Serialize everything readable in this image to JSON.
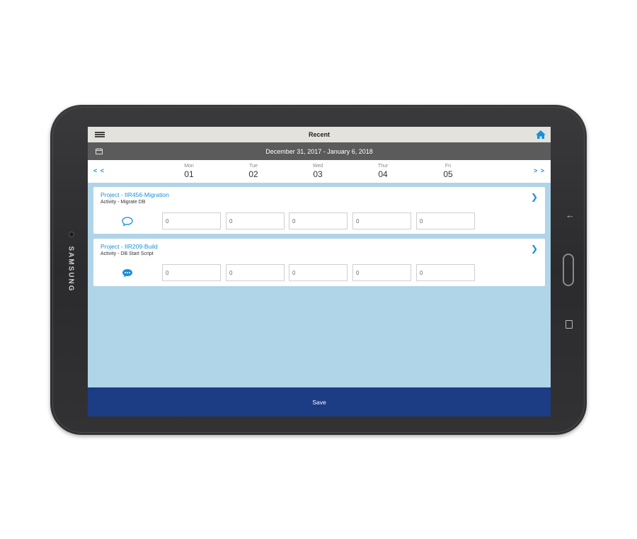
{
  "device": {
    "brand": "SAMSUNG"
  },
  "header": {
    "title": "Recent"
  },
  "date_range": {
    "label": "December 31, 2017 - January 6, 2018"
  },
  "week_nav": {
    "prev": "< <",
    "next": "> >"
  },
  "days": [
    {
      "name": "Mon",
      "date": "01"
    },
    {
      "name": "Tue",
      "date": "02"
    },
    {
      "name": "Wed",
      "date": "03"
    },
    {
      "name": "Thur",
      "date": "04"
    },
    {
      "name": "Fri",
      "date": "05"
    }
  ],
  "entries": [
    {
      "project": "Project - IIR456-Migration",
      "activity": "Activity - Migrate DB",
      "hours": [
        "0",
        "0",
        "0",
        "0",
        "0"
      ],
      "comment_icon": "speech-bubble-outline-icon"
    },
    {
      "project": "Project - IIR209-Build",
      "activity": "Activity - DB Start Script",
      "hours": [
        "0",
        "0",
        "0",
        "0",
        "0"
      ],
      "comment_icon": "speech-bubble-filled-icon"
    }
  ],
  "footer": {
    "save_label": "Save"
  },
  "colors": {
    "accent": "#1a8fd8",
    "header_bg": "#e3e2dd",
    "datebar_bg": "#5b5b5b",
    "content_bg": "#b0d4e8",
    "save_bg": "#1c3c84"
  }
}
